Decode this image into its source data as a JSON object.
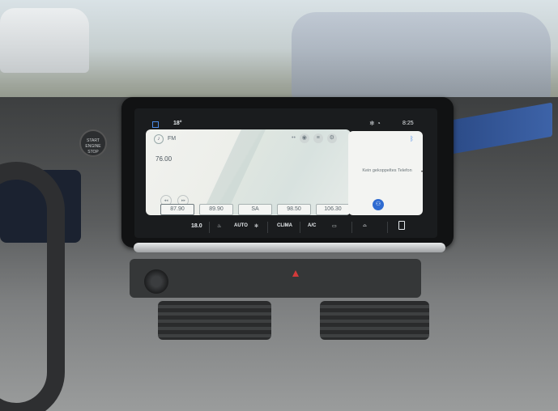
{
  "status_bar": {
    "temperature": "18°",
    "time": "8:25",
    "icons": [
      "home-icon",
      "climate-icon",
      "wifi-icon"
    ]
  },
  "radio": {
    "band": "FM",
    "frequency": "76.00",
    "presets": [
      "87.90",
      "89.90",
      "SA",
      "98.50",
      "106.30"
    ],
    "active_preset_index": 0
  },
  "phone": {
    "message": "Kein gekoppeltes Telefon",
    "icons": [
      "bluetooth-icon",
      "phone-connect-icon"
    ]
  },
  "climate": {
    "set_temperature": "18.0",
    "auto_label": "AUTO",
    "clima_label": "CLIMA",
    "ac_label": "A/C"
  },
  "start_button": {
    "line1": "START",
    "line2": "ENGINE",
    "line3": "STOP"
  },
  "colors": {
    "accent": "#4b8be8",
    "screen_bg": "#1a1c1e",
    "panel_bg": "#f3f4f2"
  }
}
